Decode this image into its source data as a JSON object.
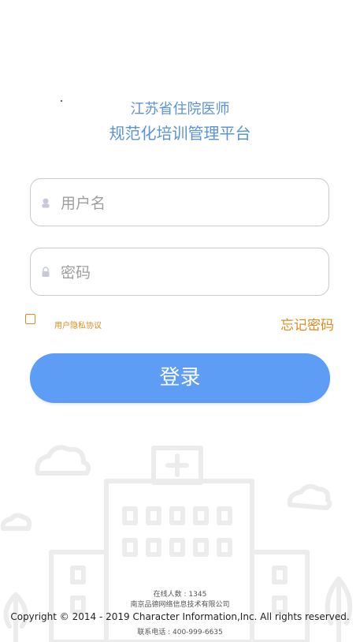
{
  "title": {
    "line1": "江苏省住院医师",
    "line2": "规范化培训管理平台"
  },
  "login_form": {
    "username": {
      "placeholder": "用户名",
      "value": "",
      "icon": "user-icon"
    },
    "password": {
      "placeholder": "密码",
      "value": "",
      "icon": "lock-icon"
    },
    "privacy_label": "用户隐私协议",
    "privacy_checked": false,
    "forgot_label": "忘记密码",
    "login_label": "登录"
  },
  "footer": {
    "online_count": "在线人数 : 1345",
    "company": "南京品德网络信息技术有限公司",
    "copyright": "Copyright © 2014 - 2019 Character Information,Inc. All rights reserved.",
    "phone": "联系电话 : 400-999-6635"
  },
  "colors": {
    "title_blue": "#5b93d8",
    "button_blue": "#5e9df5",
    "accent_orange": "#e08a1e",
    "field_border": "#c9c9c9",
    "illustration_gray": "#eeeeee"
  }
}
